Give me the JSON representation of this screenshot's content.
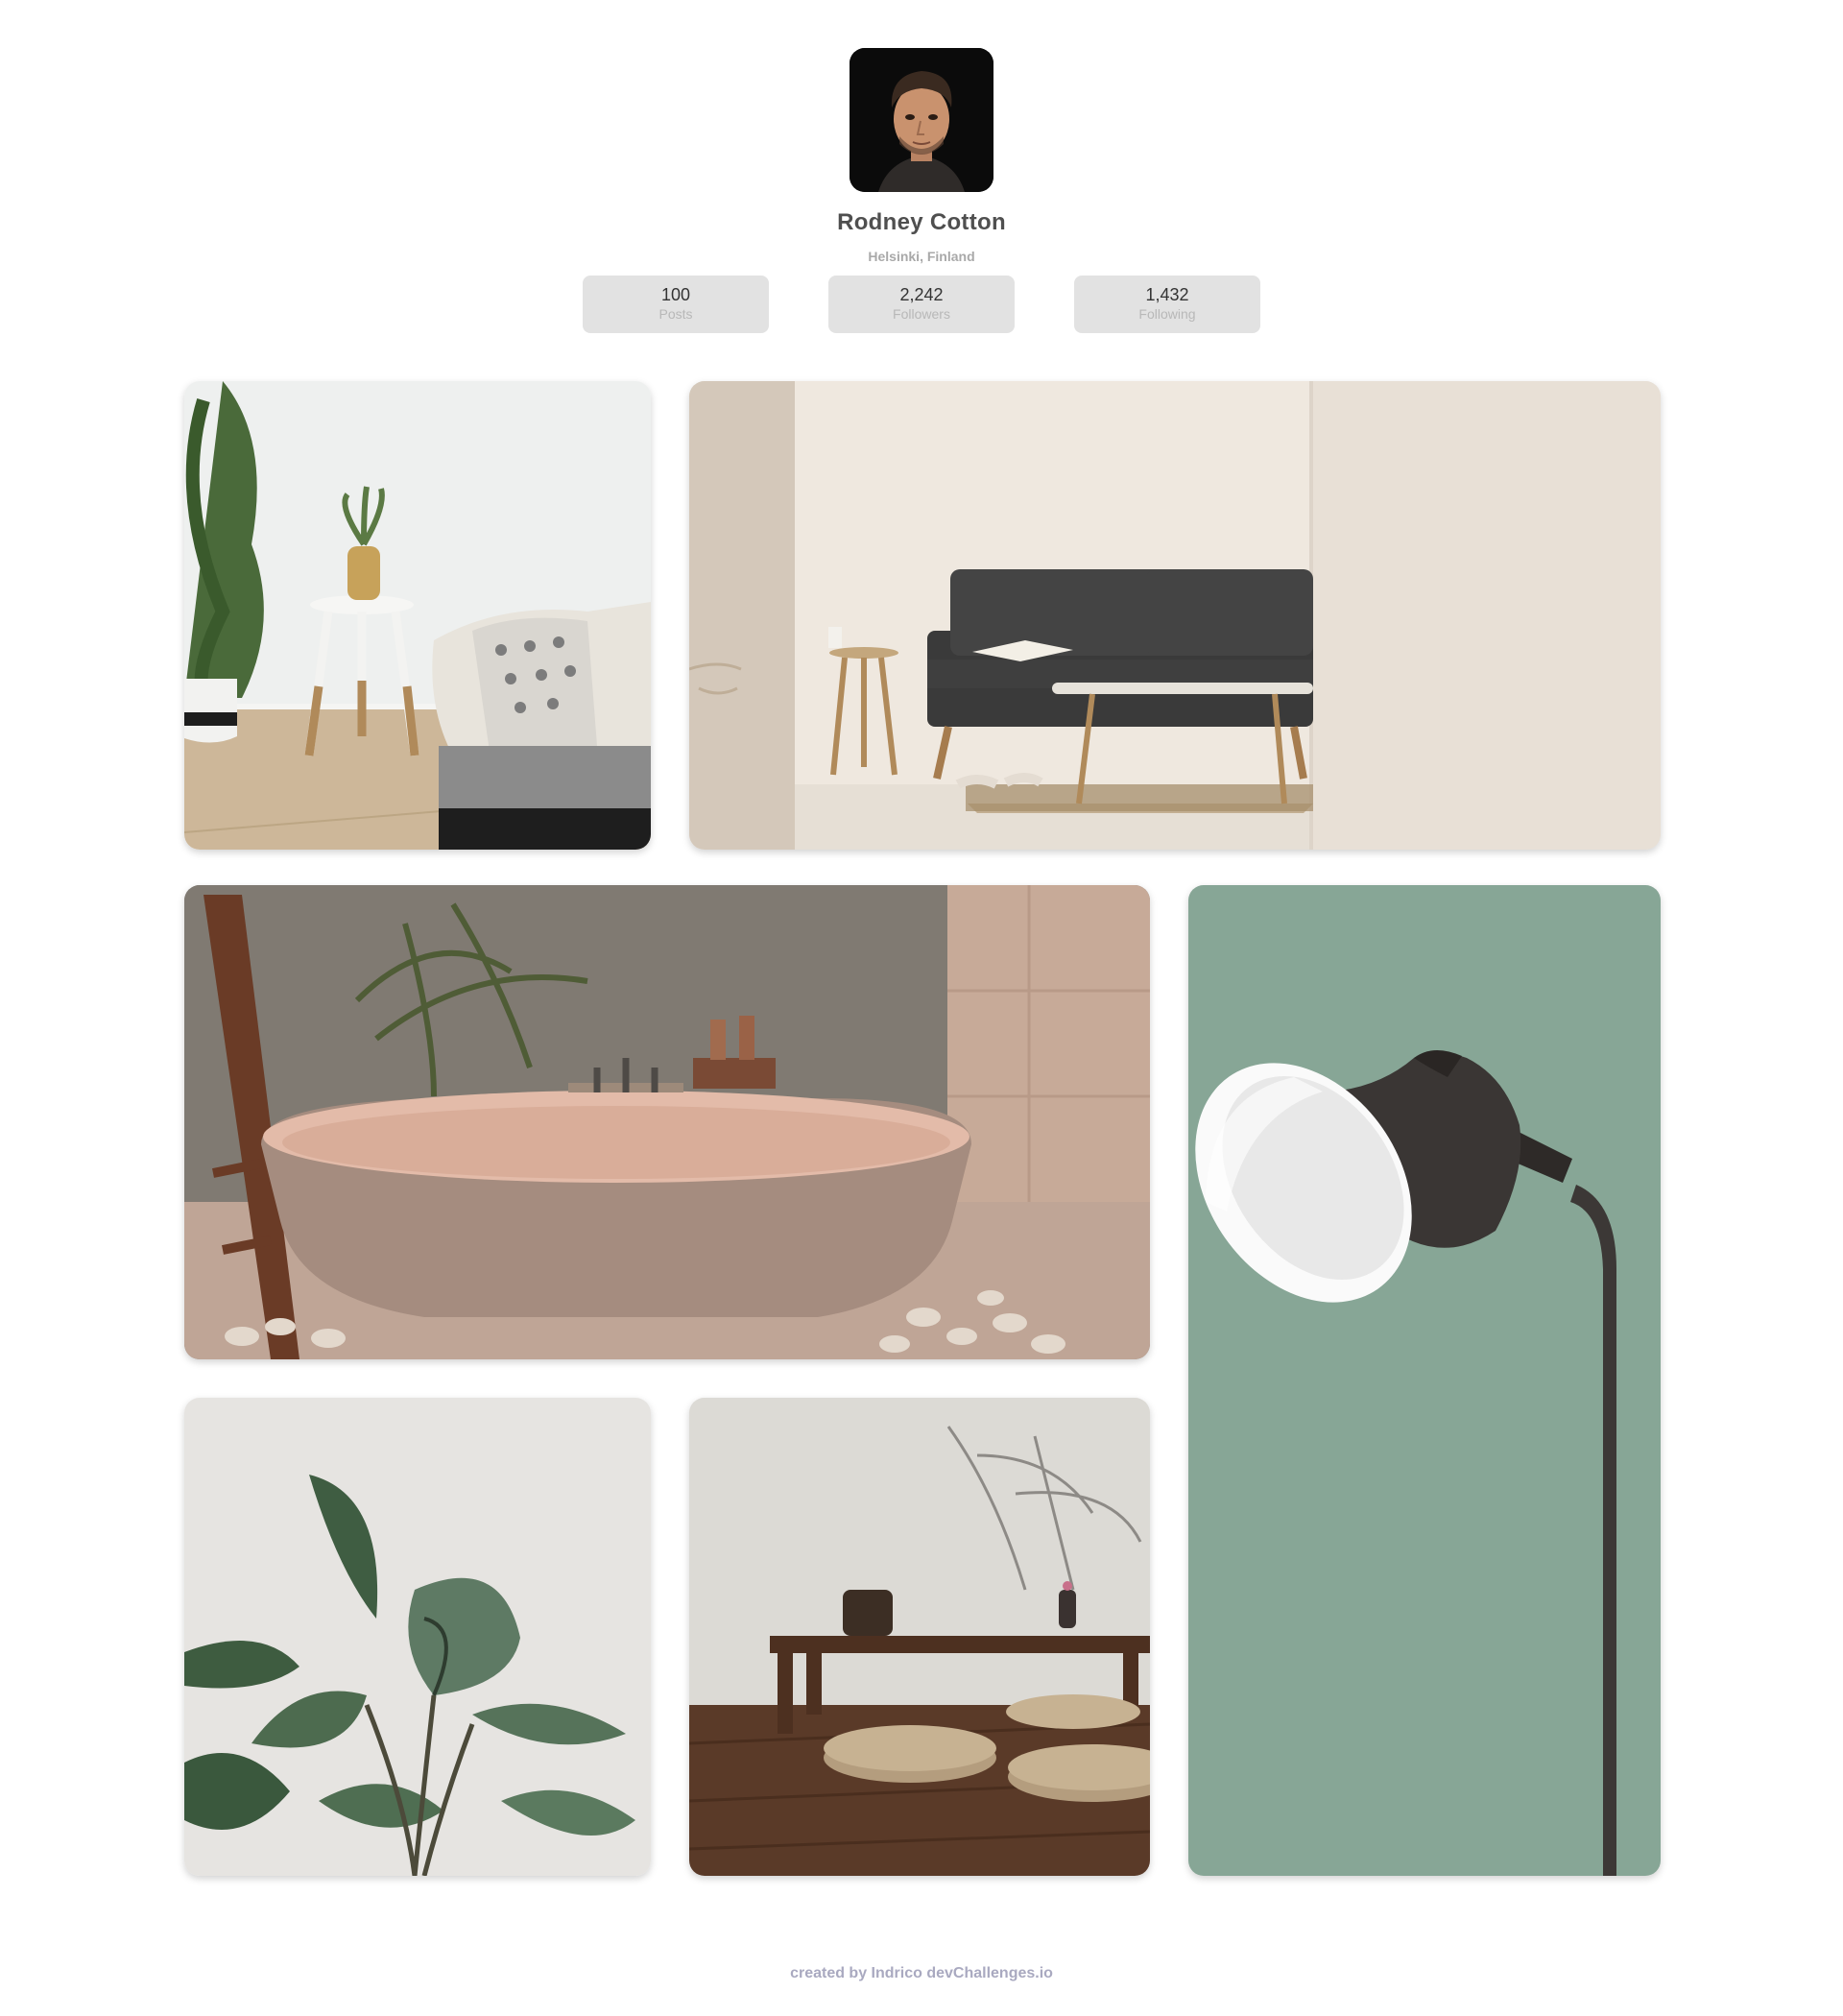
{
  "profile": {
    "name": "Rodney Cotton",
    "location": "Helsinki, Finland",
    "avatar_icon": "person-portrait",
    "stats": [
      {
        "value": "100",
        "label": "Posts"
      },
      {
        "value": "2,242",
        "label": "Followers"
      },
      {
        "value": "1,432",
        "label": "Following"
      }
    ]
  },
  "gallery": {
    "photos": [
      {
        "subject": "bedroom-with-plant"
      },
      {
        "subject": "living-room-sofa"
      },
      {
        "subject": "stone-bathtub"
      },
      {
        "subject": "floor-lamp-green-wall"
      },
      {
        "subject": "rubber-plant-leaves"
      },
      {
        "subject": "low-table-floor-cushions"
      }
    ]
  },
  "footer": {
    "credit": "created by Indrico devChallenges.io"
  },
  "colors": {
    "stat_bg": "#e2e2e2",
    "name": "#4f4f4f",
    "muted": "#a9a9a9",
    "footer": "#a9a9c0",
    "lamp_wall": "#8aa898"
  }
}
